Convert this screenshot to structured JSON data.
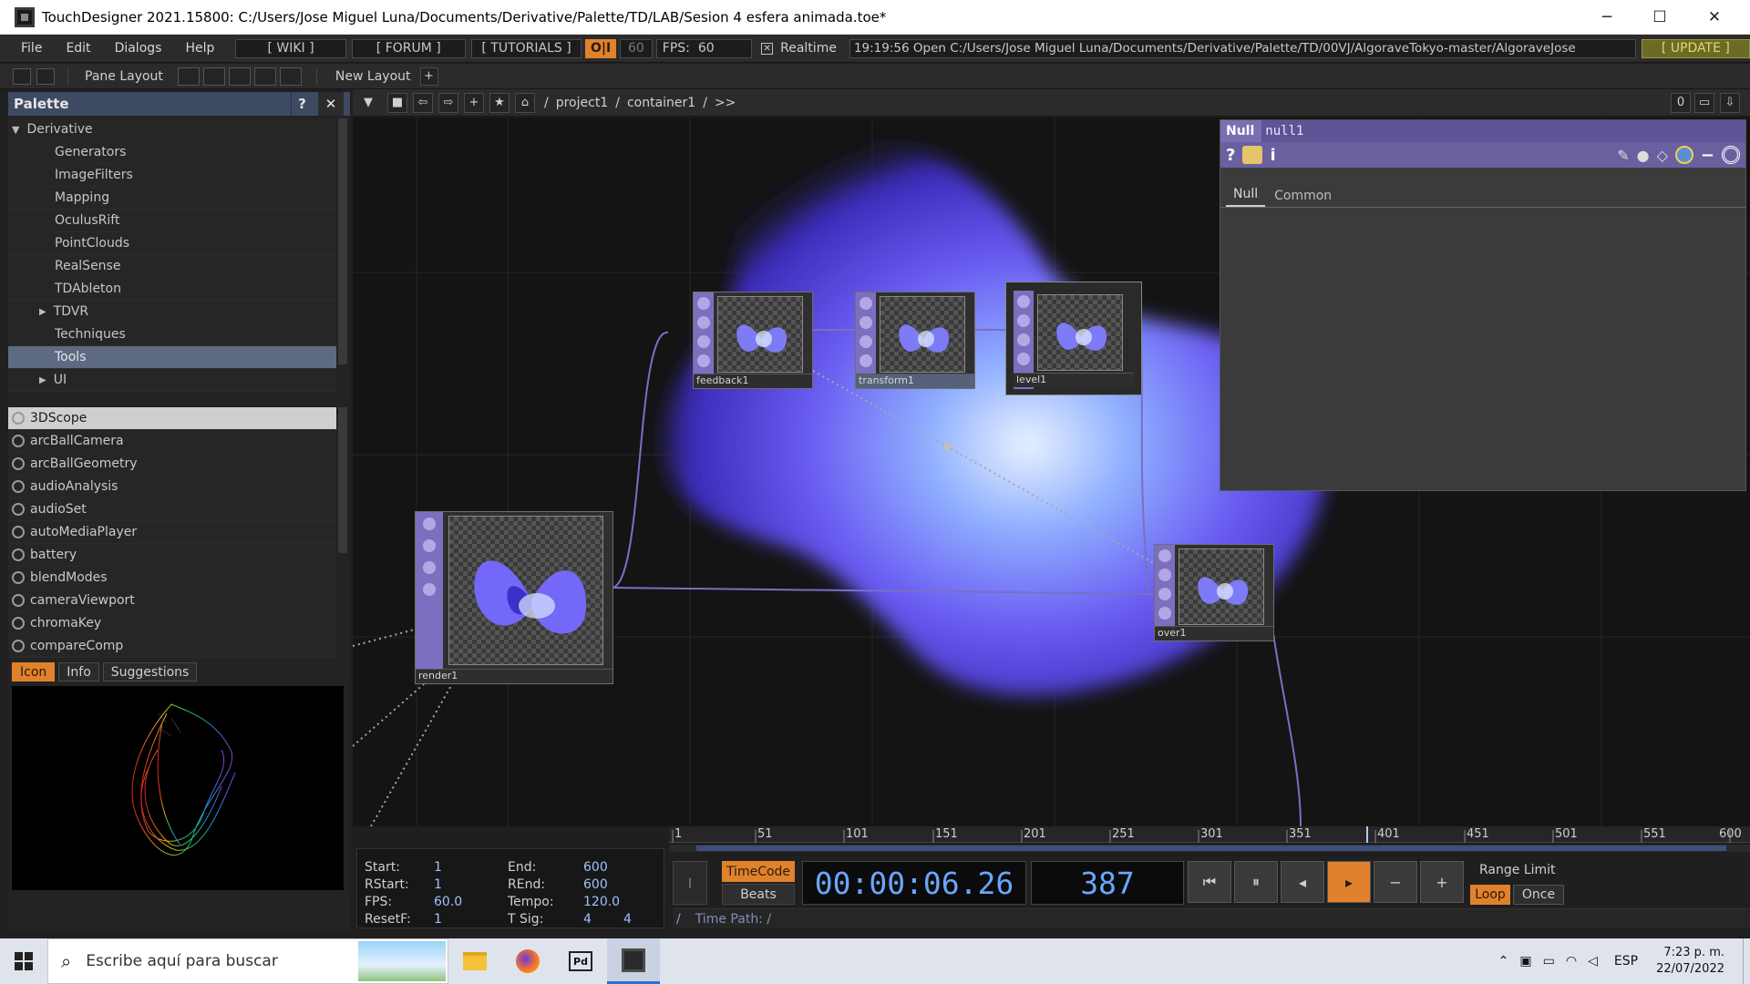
{
  "window": {
    "title": "TouchDesigner 2021.15800: C:/Users/Jose Miguel Luna/Documents/Derivative/Palette/TD/LAB/Sesion 4 esfera animada.toe*",
    "minimize": "─",
    "maximize": "☐",
    "close": "✕"
  },
  "menubar": {
    "items": [
      "File",
      "Edit",
      "Dialogs",
      "Help"
    ],
    "wiki": "[ WIKI ]",
    "forum": "[ FORUM ]",
    "tutorials": "[ TUTORIALS ]",
    "oi": "O|I",
    "fps_target": "60",
    "fps_label": "FPS:",
    "fps_value": "60",
    "realtime": "Realtime",
    "status": "19:19:56 Open C:/Users/Jose Miguel Luna/Documents/Derivative/Palette/TD/00VJ/AlgoraveTokyo-master/AlgoraveJose",
    "update": "[ UPDATE ]"
  },
  "toolbar": {
    "pane_layout": "Pane Layout",
    "new_layout": "New Layout",
    "add": "+"
  },
  "palette": {
    "title": "Palette",
    "help": "?",
    "close": "✕",
    "root": "Derivative",
    "folders": [
      "Generators",
      "ImageFilters",
      "Mapping",
      "OculusRift",
      "PointClouds",
      "RealSense",
      "TDAbleton",
      "TDVR",
      "Techniques",
      "Tools",
      "UI"
    ],
    "components": [
      "3DScope",
      "arcBallCamera",
      "arcBallGeometry",
      "audioAnalysis",
      "audioSet",
      "autoMediaPlayer",
      "battery",
      "blendModes",
      "cameraViewport",
      "chromaKey",
      "compareComp"
    ],
    "tabs": [
      "Icon",
      "Info",
      "Suggestions"
    ]
  },
  "network": {
    "path_root": "/",
    "path": [
      "project1",
      "container1"
    ],
    "path_more": ">>",
    "counter": "0",
    "nodes": {
      "feedback": "feedback1",
      "transform": "transform1",
      "level": "level1",
      "render": "render1",
      "over": "over1"
    }
  },
  "params": {
    "type": "Null",
    "name": "null1",
    "tabs": [
      "Null",
      "Common"
    ]
  },
  "timeline": {
    "ticks": [
      "1",
      "51",
      "101",
      "151",
      "201",
      "251",
      "301",
      "351",
      "401",
      "451",
      "501",
      "551",
      "600"
    ],
    "start_label": "Start:",
    "start": "1",
    "end_label": "End:",
    "end": "600",
    "rstart_label": "RStart:",
    "rstart": "1",
    "rend_label": "REnd:",
    "rend": "600",
    "fps_label": "FPS:",
    "fps": "60.0",
    "tempo_label": "Tempo:",
    "tempo": "120.0",
    "resetf_label": "ResetF:",
    "resetf": "1",
    "tsig_label": "T Sig:",
    "tsig_a": "4",
    "tsig_b": "4",
    "timecode_btn": "TimeCode",
    "beats_btn": "Beats",
    "timecode": "00:00:06.26",
    "frame": "387",
    "range_limit": "Range Limit",
    "loop": "Loop",
    "once": "Once",
    "time_path": "Time Path: /",
    "playhead_fraction": 0.645
  },
  "taskbar": {
    "search_placeholder": "Escribe aquí para buscar",
    "lang": "ESP",
    "time": "7:23 p. m.",
    "date": "22/07/2022"
  },
  "colors": {
    "accent": "#e0822c",
    "palette_header": "#3d4a62",
    "param_header": "#7a6fb3",
    "blob": "#6b5cf0"
  }
}
